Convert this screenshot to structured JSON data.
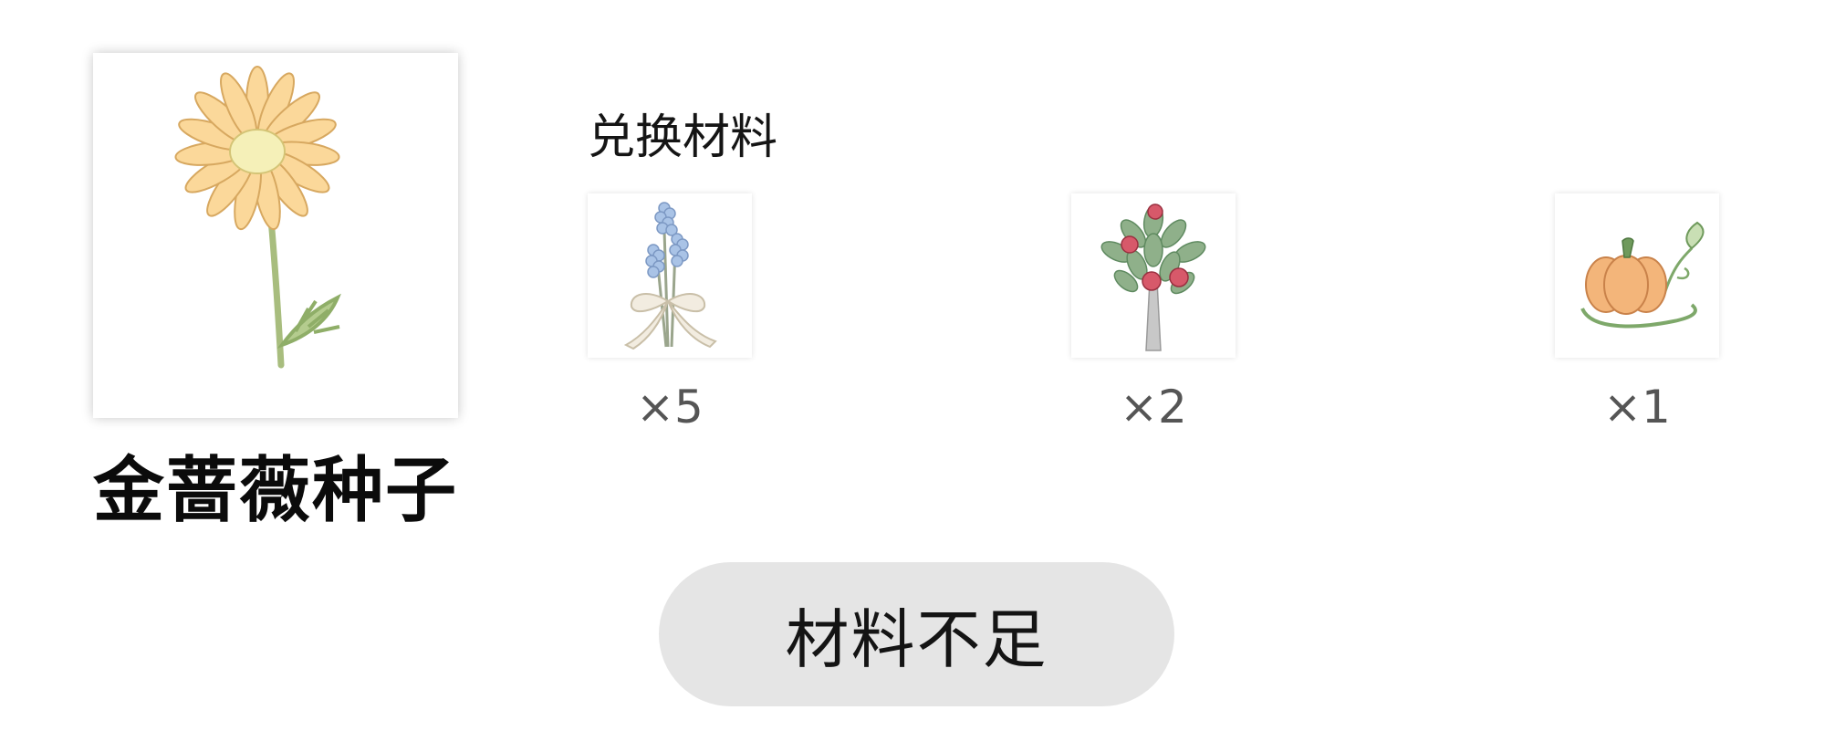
{
  "product": {
    "name": "金蔷薇种子",
    "image_icon": "daisy-flower-icon"
  },
  "materials": {
    "heading": "兑换材料",
    "items": [
      {
        "icon": "lavender-bouquet-icon",
        "quantity": "×5"
      },
      {
        "icon": "pomegranate-tree-icon",
        "quantity": "×2"
      },
      {
        "icon": "pumpkin-icon",
        "quantity": "×1"
      }
    ]
  },
  "action": {
    "label": "材料不足",
    "background": "#e5e5e5"
  }
}
